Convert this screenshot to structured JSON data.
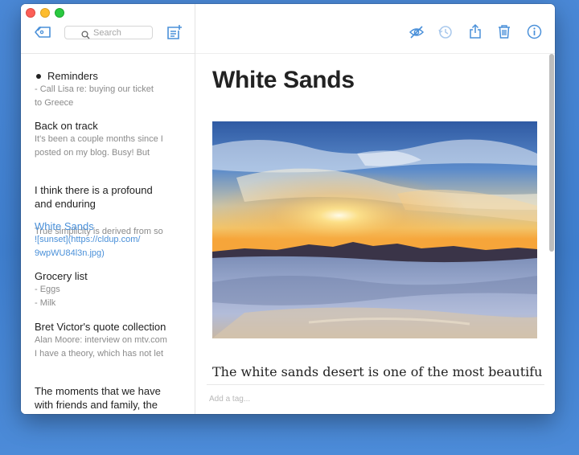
{
  "colors": {
    "accent": "#4a90d9",
    "desktop": "#4a88d6"
  },
  "sidebar": {
    "search": {
      "placeholder": "Search"
    },
    "notes": [
      {
        "title": "Reminders",
        "preview": "- Call Lisa re: buying our ticket\nto Greece"
      },
      {
        "title": "Back on track",
        "preview": "It's been a couple months since I\nposted on my blog. Busy! But"
      },
      {
        "title": "I think there is a profound\nand enduring",
        "preview": "True simplicity is derived from so"
      },
      {
        "title": "White Sands",
        "preview": "![sunset](https://cldup.com/\n9wpWU84l3n.jpg)"
      },
      {
        "title": "Grocery list",
        "preview": "- Eggs\n- Milk"
      },
      {
        "title": "Bret Victor's quote collection",
        "preview": "Alan Moore: interview on mtv.com\nI have a theory, which has not let"
      },
      {
        "title": "The moments that we have\nwith friends and family, the\nchances that we have to",
        "preview": ""
      }
    ]
  },
  "editor": {
    "title": "White Sands",
    "body_first_line": "The white sands desert is one of the most beautiful",
    "tag_placeholder": "Add a tag..."
  },
  "icons": {
    "tags": "tag-icon",
    "search": "search-icon",
    "new_note": "new-note-icon",
    "preview": "eye-slash-icon",
    "history": "history-icon",
    "share": "share-icon",
    "trash": "trash-icon",
    "info": "info-icon"
  }
}
